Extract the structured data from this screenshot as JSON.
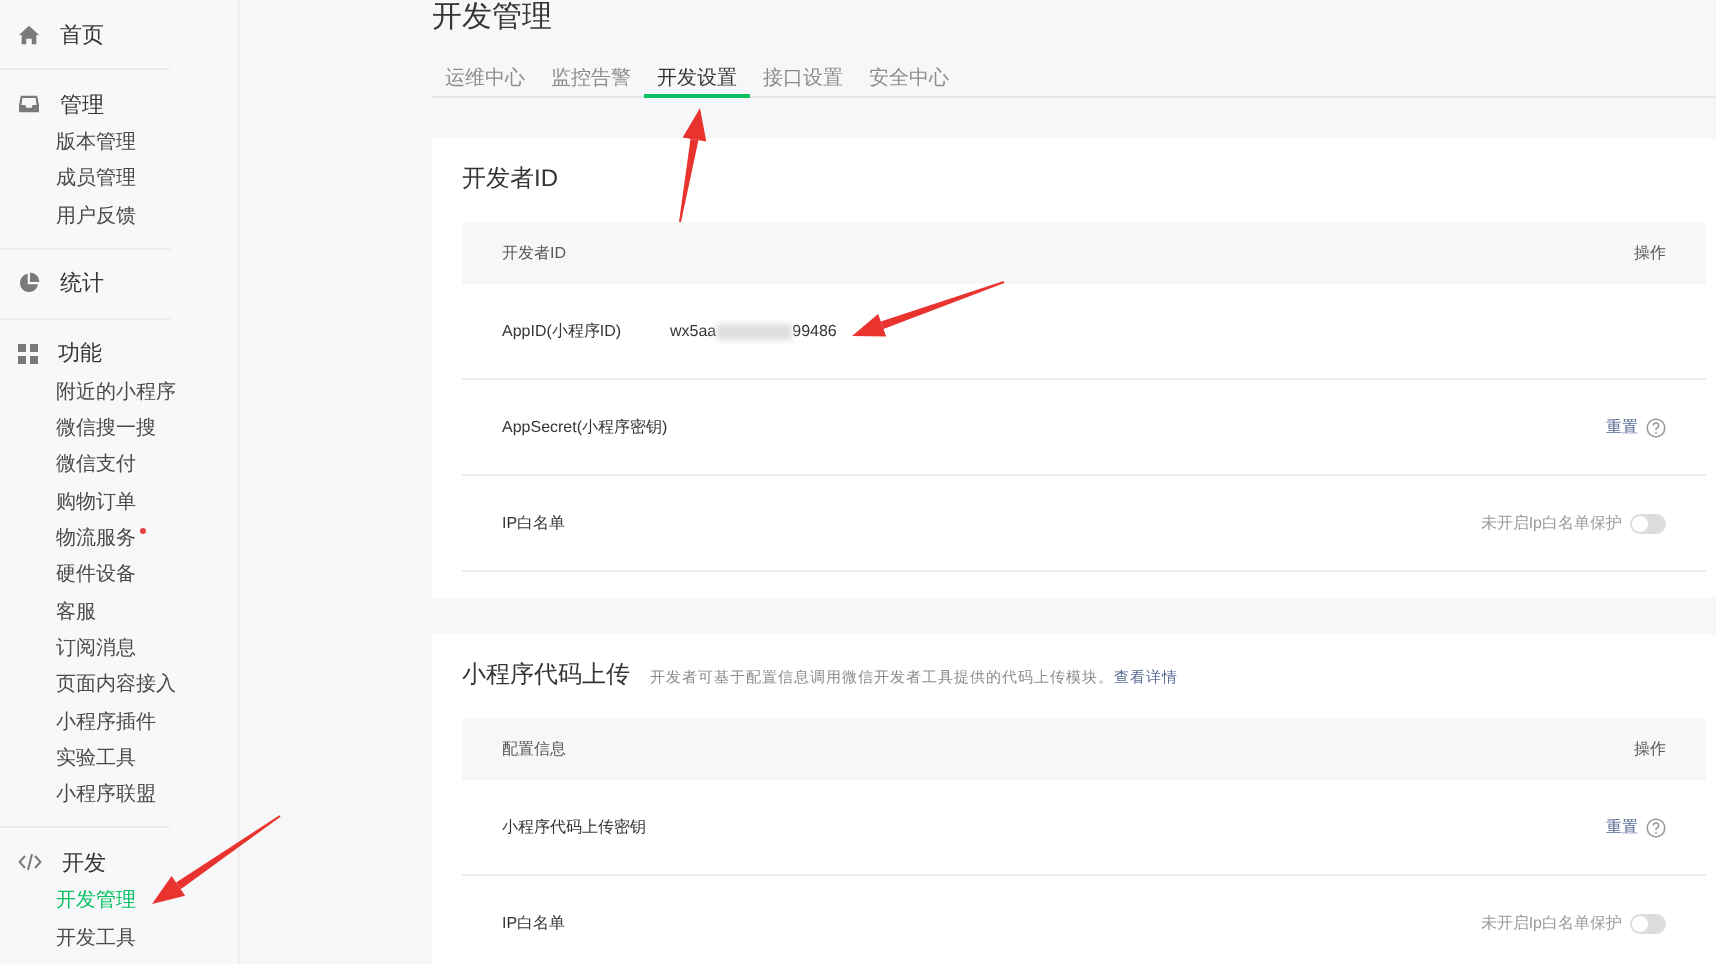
{
  "sidebar": {
    "groups": [
      {
        "kind": "home",
        "title": "首页"
      },
      {
        "kind": "inbox",
        "title": "管理",
        "items": [
          {
            "label": "版本管理",
            "selected": false,
            "dot": false
          },
          {
            "label": "成员管理",
            "selected": false,
            "dot": false
          },
          {
            "label": "用户反馈",
            "selected": false,
            "dot": false
          }
        ]
      },
      {
        "kind": "pie",
        "title": "统计"
      },
      {
        "kind": "grid",
        "title": "功能",
        "items": [
          {
            "label": "附近的小程序",
            "selected": false,
            "dot": false
          },
          {
            "label": "微信搜一搜",
            "selected": false,
            "dot": false
          },
          {
            "label": "微信支付",
            "selected": false,
            "dot": false
          },
          {
            "label": "购物订单",
            "selected": false,
            "dot": false
          },
          {
            "label": "物流服务",
            "selected": false,
            "dot": true
          },
          {
            "label": "硬件设备",
            "selected": false,
            "dot": false
          },
          {
            "label": "客服",
            "selected": false,
            "dot": false
          },
          {
            "label": "订阅消息",
            "selected": false,
            "dot": false
          },
          {
            "label": "页面内容接入",
            "selected": false,
            "dot": false
          },
          {
            "label": "小程序插件",
            "selected": false,
            "dot": false
          },
          {
            "label": "实验工具",
            "selected": false,
            "dot": false
          },
          {
            "label": "小程序联盟",
            "selected": false,
            "dot": false
          }
        ]
      },
      {
        "kind": "code",
        "title": "开发",
        "items": [
          {
            "label": "开发管理",
            "selected": true,
            "dot": false
          },
          {
            "label": "开发工具",
            "selected": false,
            "dot": false
          }
        ]
      }
    ]
  },
  "title": "开发管理",
  "tabs": [
    {
      "label": "运维中心",
      "selected": false
    },
    {
      "label": "监控告警",
      "selected": false
    },
    {
      "label": "开发设置",
      "selected": true
    },
    {
      "label": "接口设置",
      "selected": false
    },
    {
      "label": "安全中心",
      "selected": false
    }
  ],
  "sections": [
    {
      "title": "开发者ID",
      "columns": [
        "开发者ID",
        "操作"
      ],
      "rows": [
        {
          "kind": "value",
          "label": "AppID(小程序ID)",
          "value_prefix": "wx5aa",
          "value_suffix": "99486"
        },
        {
          "kind": "reset",
          "label": "AppSecret(小程序密钥)",
          "action": "重置"
        },
        {
          "kind": "toggle",
          "label": "IP白名单",
          "status": "未开启Ip白名单保护",
          "on": false
        }
      ]
    },
    {
      "title": "小程序代码上传",
      "description": "开发者可基于配置信息调用微信开发者工具提供的代码上传模块。",
      "link": "查看详情",
      "columns": [
        "配置信息",
        "操作"
      ],
      "rows": [
        {
          "kind": "reset",
          "label": "小程序代码上传密钥",
          "action": "重置"
        },
        {
          "kind": "toggle",
          "label": "IP白名单",
          "status": "未开启Ip白名单保护",
          "on": false
        }
      ]
    }
  ]
}
